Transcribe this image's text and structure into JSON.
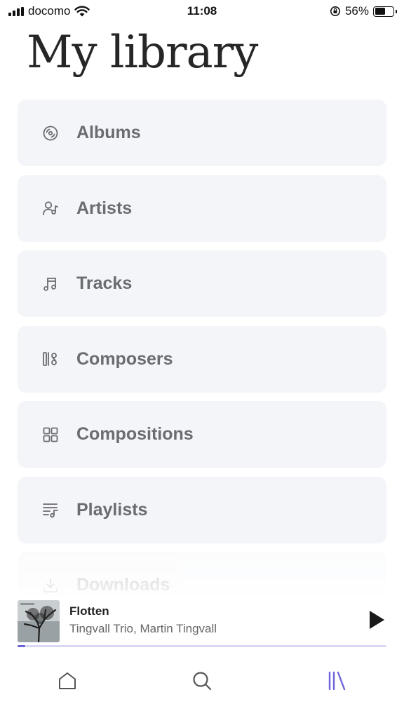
{
  "status_bar": {
    "carrier": "docomo",
    "time": "11:08",
    "battery_percent": "56%",
    "battery_level": 0.56
  },
  "page_title": "My library",
  "library": {
    "items": [
      {
        "label": "Albums",
        "icon": "album-icon"
      },
      {
        "label": "Artists",
        "icon": "artist-icon"
      },
      {
        "label": "Tracks",
        "icon": "music-note-icon"
      },
      {
        "label": "Composers",
        "icon": "composer-icon"
      },
      {
        "label": "Compositions",
        "icon": "grid-icon"
      },
      {
        "label": "Playlists",
        "icon": "playlist-icon"
      },
      {
        "label": "Downloads",
        "icon": "download-icon"
      }
    ]
  },
  "now_playing": {
    "title": "Flotten",
    "artist": "Tingvall Trio, Martin Tingvall",
    "progress": 0.02
  },
  "tab_bar": {
    "tabs": [
      {
        "name": "home",
        "icon": "home-icon"
      },
      {
        "name": "search",
        "icon": "search-icon"
      },
      {
        "name": "library",
        "icon": "library-icon",
        "active": true
      }
    ]
  },
  "colors": {
    "accent": "#6c63d9",
    "item_background": "#f4f5f9",
    "item_text": "#6b6b72"
  }
}
